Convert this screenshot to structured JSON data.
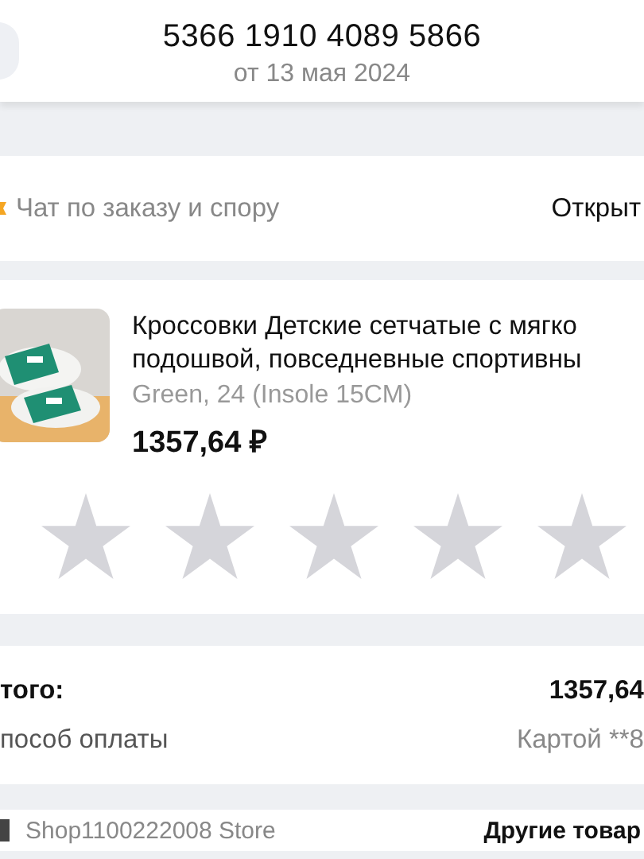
{
  "header": {
    "order_number": "5366 1910 4089 5866",
    "date": "от 13 мая 2024"
  },
  "chat": {
    "label": "Чат по заказу и спору",
    "action": "Открыт"
  },
  "product": {
    "title_lines": [
      "Кроссовки Детские сетчатые с мягко",
      "подошвой, повседневные спортивны"
    ],
    "variant": "Green, 24  (Insole 15CM)",
    "price": "1357,64 ₽",
    "stars": 0
  },
  "summary": [
    {
      "label": "того:",
      "value": "1357,64",
      "kind": "total"
    },
    {
      "label": "пособ оплаты",
      "value": "Картой **8",
      "kind": "payment"
    }
  ],
  "shop": {
    "name": "Shop1100222008 Store",
    "action": "Другие товар"
  }
}
